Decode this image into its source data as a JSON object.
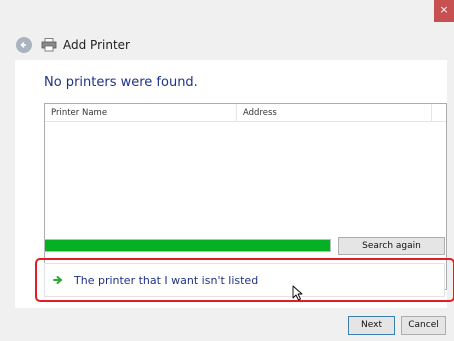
{
  "window": {
    "title": "Add Printer",
    "close_glyph": "×"
  },
  "main": {
    "heading": "No printers were found.",
    "table": {
      "columns": [
        "Printer Name",
        "Address"
      ],
      "rows": []
    },
    "progress": {
      "fraction": 1.0
    },
    "search_again_label": "Search again",
    "not_listed_link": "The printer that I want isn't listed"
  },
  "footer": {
    "next_label": "Next",
    "cancel_label": "Cancel"
  },
  "colors": {
    "accent": "#1e3287",
    "progress": "#06b025",
    "highlight": "#e51c23",
    "close": "#c75050"
  },
  "icons": [
    "back-arrow-icon",
    "printer-icon",
    "green-arrow-icon",
    "mouse-cursor-icon"
  ]
}
